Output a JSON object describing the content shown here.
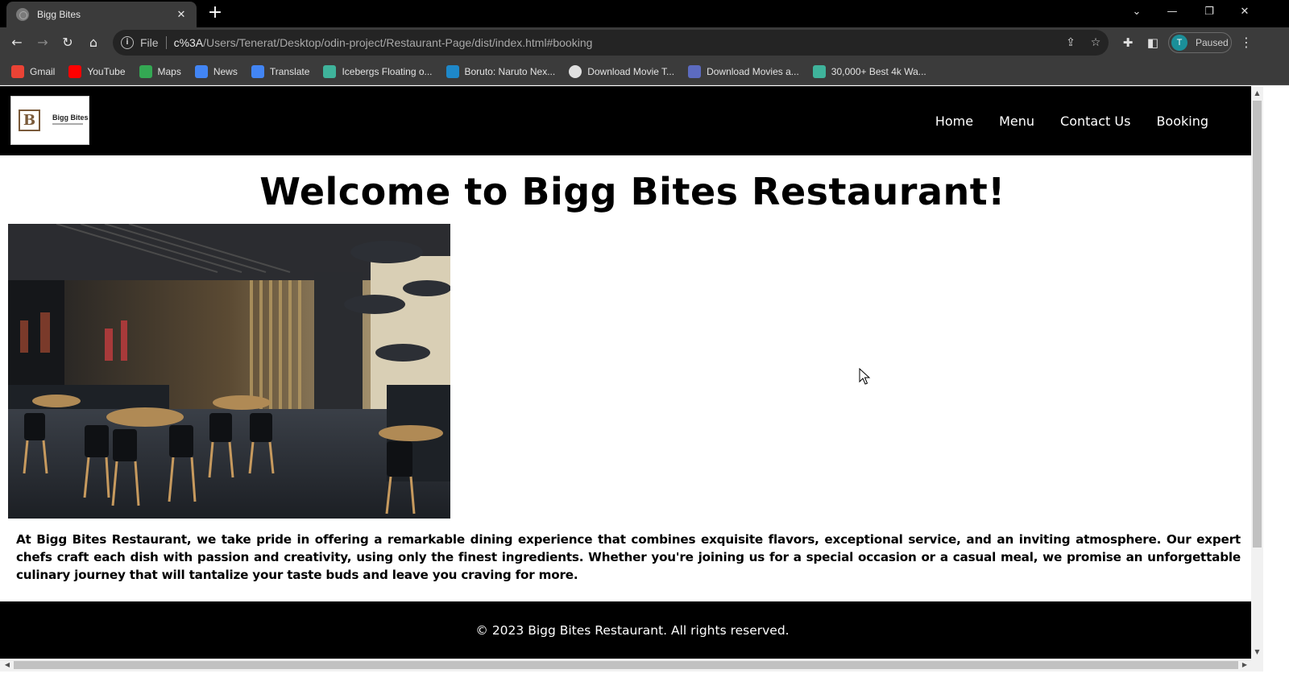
{
  "browser": {
    "tab_title": "Bigg Bites",
    "new_tab": "+",
    "url_prefix": "c%3A",
    "url_path": "/Users/Tenerat/Desktop/odin-project/Restaurant-Page/dist/index.html#booking",
    "file_label": "File",
    "profile_initial": "T",
    "profile_status": "Paused"
  },
  "bookmarks": [
    {
      "label": "Gmail",
      "icon": "gmail-icon",
      "color": "#ea4335"
    },
    {
      "label": "YouTube",
      "icon": "youtube-icon",
      "color": "#ff0000"
    },
    {
      "label": "Maps",
      "icon": "maps-icon",
      "color": "#34a853"
    },
    {
      "label": "News",
      "icon": "news-icon",
      "color": "#4285f4"
    },
    {
      "label": "Translate",
      "icon": "translate-icon",
      "color": "#4285f4"
    },
    {
      "label": "Icebergs Floating o...",
      "icon": "bookmark-site-icon",
      "color": "#3fb39b"
    },
    {
      "label": "Boruto: Naruto Nex...",
      "icon": "bookmark-site-icon",
      "color": "#1e88c9"
    },
    {
      "label": "Download Movie T...",
      "icon": "globe-icon",
      "color": "#e0e0e0"
    },
    {
      "label": "Download Movies a...",
      "icon": "bookmark-site-icon",
      "color": "#5c6bc0"
    },
    {
      "label": "30,000+ Best 4k Wa...",
      "icon": "bookmark-site-icon",
      "color": "#3fb39b"
    }
  ],
  "site": {
    "logo_letter": "B",
    "logo_text": "Bigg Bites",
    "nav": [
      "Home",
      "Menu",
      "Contact Us",
      "Booking"
    ],
    "hero_title": "Welcome to Bigg Bites Restaurant!",
    "about": "At Bigg Bites Restaurant, we take pride in offering a remarkable dining experience that combines exquisite flavors, exceptional service, and an inviting atmosphere. Our expert chefs craft each dish with passion and creativity, using only the finest ingredients. Whether you're joining us for a special occasion or a casual meal, we promise an unforgettable culinary journey that will tantalize your taste buds and leave you craving for more.",
    "footer": "© 2023 Bigg Bites Restaurant. All rights reserved."
  },
  "colors": {
    "header_bg": "#000000",
    "footer_bg": "#000000",
    "logo_brown": "#7a5a3a",
    "chrome_bg": "#3b3b3b"
  }
}
